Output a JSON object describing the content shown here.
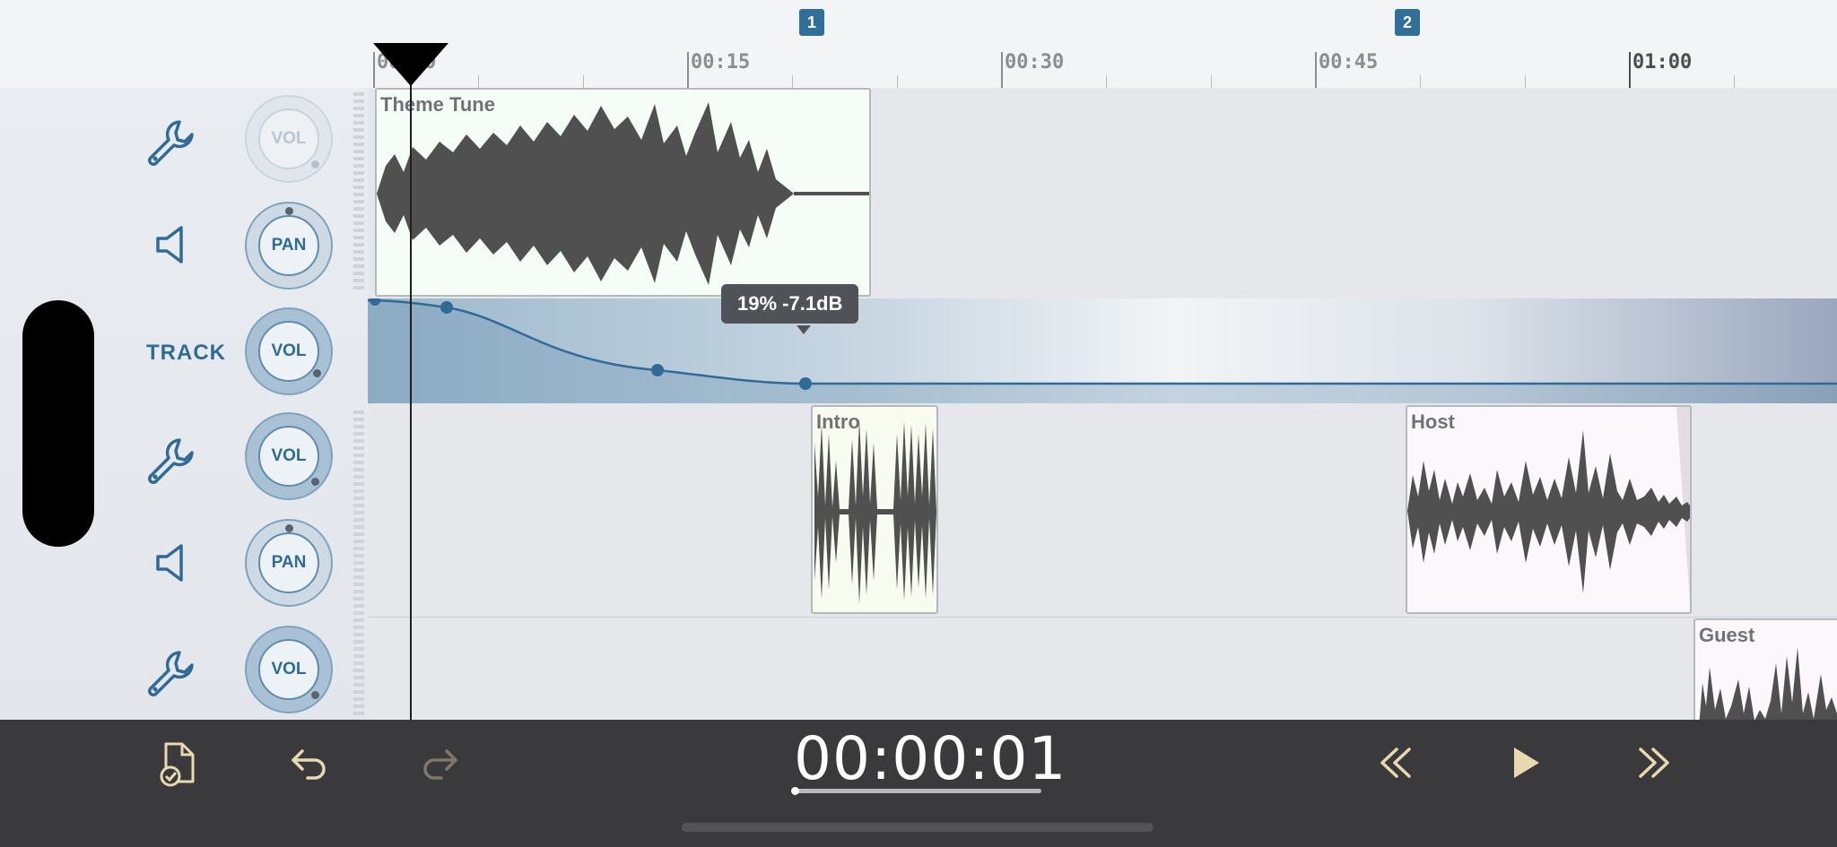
{
  "ruler": {
    "ticks": [
      "00:00",
      "00:15",
      "00:30",
      "00:45",
      "01:00"
    ],
    "markers": [
      "1",
      "2"
    ]
  },
  "tracks": {
    "track1": {
      "knob_vol": "VOL",
      "knob_pan": "PAN",
      "clip": "Theme Tune"
    },
    "master": {
      "label": "TRACK",
      "knob_vol": "VOL",
      "tooltip": "19% -7.1dB"
    },
    "track2": {
      "knob_vol": "VOL",
      "knob_pan": "PAN",
      "clip_intro": "Intro",
      "clip_host": "Host"
    },
    "track3": {
      "knob_vol": "VOL",
      "clip": "Guest"
    }
  },
  "transport": {
    "time": "00:00:01",
    "progress": 0.0
  },
  "colors": {
    "accent": "#2f6f9a",
    "toolbar": "#3a3a3c",
    "toolbar_icons": "#e8d9b0",
    "waveform": "#505050"
  }
}
